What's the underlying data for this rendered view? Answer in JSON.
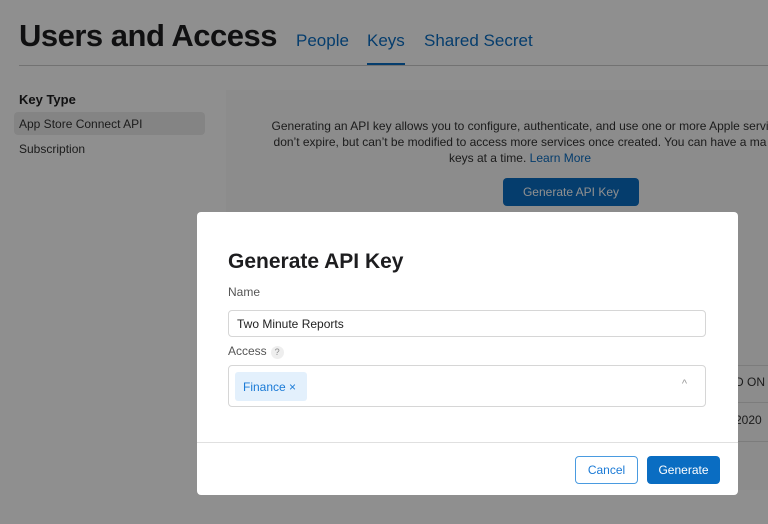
{
  "header": {
    "title": "Users and Access",
    "tabs": [
      {
        "label": "People"
      },
      {
        "label": "Keys",
        "active": true
      },
      {
        "label": "Shared Secret"
      }
    ]
  },
  "sidebar": {
    "heading": "Key Type",
    "items": [
      {
        "label": "App Store Connect API",
        "selected": true
      },
      {
        "label": "Subscription"
      }
    ]
  },
  "main": {
    "description": "Generating an API key allows you to configure, authenticate, and use one or more Apple servi",
    "description2": "don’t expire, but can’t be modified to access more services once created. You can have a ma",
    "description3": "keys at a time.",
    "learn_more": "Learn More",
    "generate_button": "Generate API Key",
    "table_fragment_header": "D ON",
    "table_fragment_cell": "2020"
  },
  "modal": {
    "title": "Generate API Key",
    "name_label": "Name",
    "name_value": "Two Minute Reports",
    "access_label": "Access",
    "help_icon": "?",
    "access_chips": [
      {
        "label": "Finance",
        "remove": "×"
      }
    ],
    "chevron": "^",
    "cancel": "Cancel",
    "generate": "Generate"
  },
  "colors": {
    "accent": "#0a6dc2",
    "chip_bg": "#e3f0fc"
  }
}
